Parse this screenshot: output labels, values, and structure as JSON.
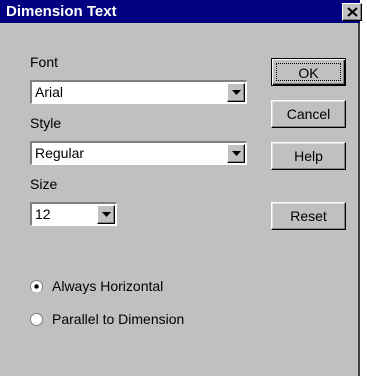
{
  "window": {
    "title": "Dimension Text"
  },
  "font": {
    "label": "Font",
    "value": "Arial"
  },
  "style": {
    "label": "Style",
    "value": "Regular"
  },
  "size": {
    "label": "Size",
    "value": "12"
  },
  "buttons": {
    "ok": "OK",
    "cancel": "Cancel",
    "help": "Help",
    "reset": "Reset"
  },
  "orientation": {
    "options": [
      {
        "label": "Always Horizontal",
        "selected": true
      },
      {
        "label": "Parallel to Dimension",
        "selected": false
      }
    ]
  }
}
